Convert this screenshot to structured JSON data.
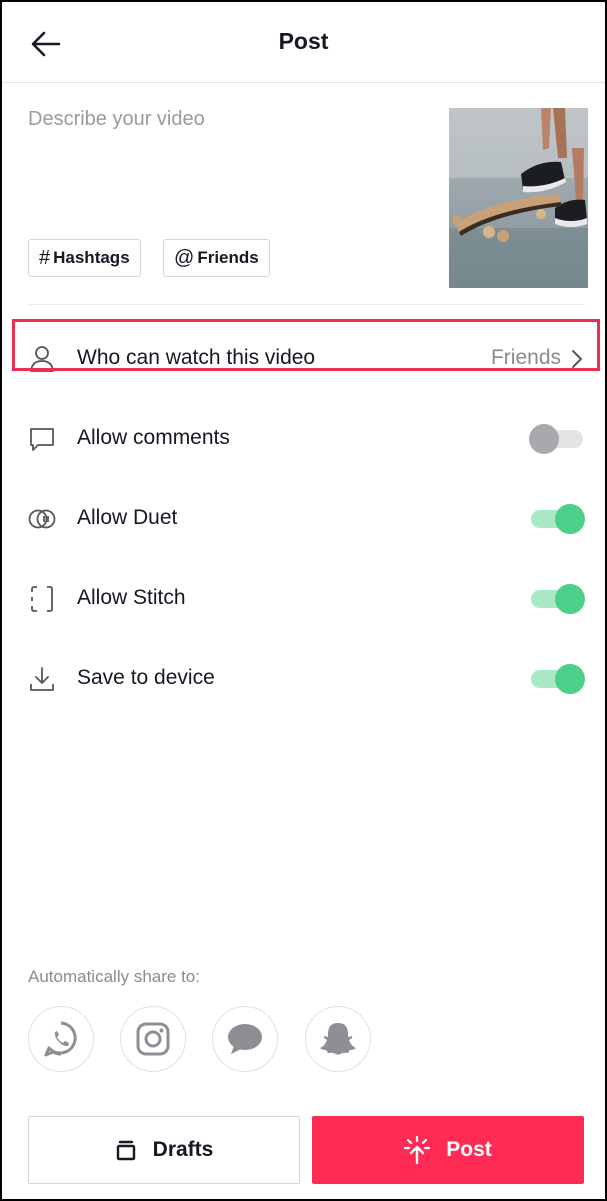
{
  "header": {
    "title": "Post"
  },
  "description": {
    "placeholder": "Describe your video"
  },
  "chips": {
    "hashtags": "Hashtags",
    "friends": "Friends"
  },
  "settings": {
    "privacy": {
      "label": "Who can watch this video",
      "value": "Friends"
    },
    "comments": {
      "label": "Allow comments",
      "enabled": false
    },
    "duet": {
      "label": "Allow Duet",
      "enabled": true
    },
    "stitch": {
      "label": "Allow Stitch",
      "enabled": true
    },
    "save": {
      "label": "Save to device",
      "enabled": true
    }
  },
  "share": {
    "label": "Automatically share to:",
    "targets": [
      "whatsapp-icon",
      "instagram-icon",
      "messages-icon",
      "snapchat-icon"
    ]
  },
  "buttons": {
    "drafts": "Drafts",
    "post": "Post"
  },
  "colors": {
    "accent": "#fe2c55",
    "toggle_on": "#4bd08a",
    "highlight": "#ea2f53"
  }
}
